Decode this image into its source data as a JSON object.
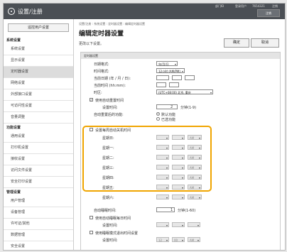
{
  "topbar": {
    "app_title": "设置/注册",
    "info_left": "部门ID",
    "info_name": "登录用户",
    "info_id": "7654321",
    "info_right": "注销",
    "logout": "注销"
  },
  "sidebar": {
    "header_button": "遥控用户设置",
    "sections": [
      {
        "title": "系统设置",
        "items": [
          "系统设置",
          "显示设置",
          "定时器设置",
          "网络设置",
          "外部接口设置",
          "可访问性设置",
          "音量调整"
        ]
      },
      {
        "title": "功能设置",
        "items": [
          "通用设置",
          "打印机设置",
          "接收设置",
          "访问文件设置",
          "安全打印设置"
        ]
      },
      {
        "title": "管理设置",
        "items": [
          "用户管理",
          "设备管理",
          "许可证/其他",
          "数据管理",
          "安全设置"
        ]
      }
    ],
    "active": "定时器设置"
  },
  "main": {
    "breadcrumb": "设置/注册 : 系统设置 : 定时器设置 : 编辑定时器设置",
    "title": "编辑定时器设置",
    "notice": "更改以下设置。",
    "ok": "确定",
    "cancel": "取消",
    "panel_header": "定时器设置",
    "date_format_label": "日期格式:",
    "date_format_value": "年/月/日",
    "time_format_label": "时间格式:",
    "time_format_value": "12小时 (AM/PM)",
    "current_date_label": "当前日期 (年 / 月 / 日):",
    "current_time_label": "当前时间 (hh:mm):",
    "timezone_label": "时区:",
    "timezone_value": "(UTC+08:00) 北京, 重庆",
    "auto_reset_label": "使用自动重置时间",
    "set_time_label": "设置时间:",
    "set_time_value": "2",
    "set_time_unit": "分钟(1-9)",
    "after_reset_label": "自动重置后的功能:",
    "after_reset_opt1": "默认功能",
    "after_reset_opt2": "已选功能",
    "weekly_label": "设置每周自动关机时间",
    "weekday_ampm": "AM",
    "days": [
      "星期日:",
      "星期一:",
      "星期二:",
      "星期三:",
      "星期四:",
      "星期五:",
      "星期六:"
    ],
    "auto_sleep_label": "自动睡眠时间:",
    "auto_sleep_value": "1",
    "auto_sleep_unit": "分钟(1-60)",
    "daily_sleep_label": "使用自动睡眠每日时间",
    "daily_time_label": "设置时间:",
    "mode_exit_label": "使用睡眠模式退出时间设置",
    "mode_time_label": "设置时间:",
    "mode_hour": "12",
    "mode_min": "00",
    "mode_ampm": "AM",
    "checkmark": "✓"
  }
}
